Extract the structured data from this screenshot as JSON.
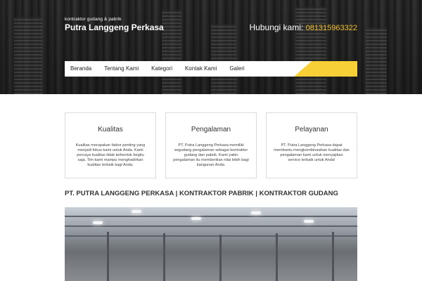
{
  "header": {
    "tagline": "kontraktor gudang & pabrik",
    "brand_name": "Putra Langgeng Perkasa",
    "contact_label": "Hubungi kami:",
    "contact_phone": "081315963322"
  },
  "nav": {
    "items": [
      {
        "label": "Beranda"
      },
      {
        "label": "Tentang Kami"
      },
      {
        "label": "Kategori"
      },
      {
        "label": "Kontak Kami"
      },
      {
        "label": "Galeri"
      }
    ]
  },
  "features": [
    {
      "title": "Kualitas",
      "text": "Kualitas merupakan faktor penting yang menjadi fokus kami untuk Anda. Kami percaya kualitas tidak terbentuk begitu saja. Tim kami mampu menghadirkan kualitas terbaik bagi Anda."
    },
    {
      "title": "Pengalaman",
      "text": "PT. Putra Langgeng Perkasa memiliki segudang pengalaman sebagai kontraktor gudang dan pabrik. Kami yakin pengalaman itu memberikan nilai lebih bagi bangunan Anda."
    },
    {
      "title": "Pelayanan",
      "text": "PT. Putra Langgeng Perkasa dapat membantu mengkombinasikan kualitas dan pengalaman kami untuk menyajikan service terbaik untuk Anda!"
    }
  ],
  "section": {
    "heading": "PT. PUTRA LANGGENG PERKASA | KONTRAKTOR PABRIK | KONTRAKTOR GUDANG"
  },
  "colors": {
    "accent": "#f7d038",
    "phone": "#f2c12e"
  }
}
